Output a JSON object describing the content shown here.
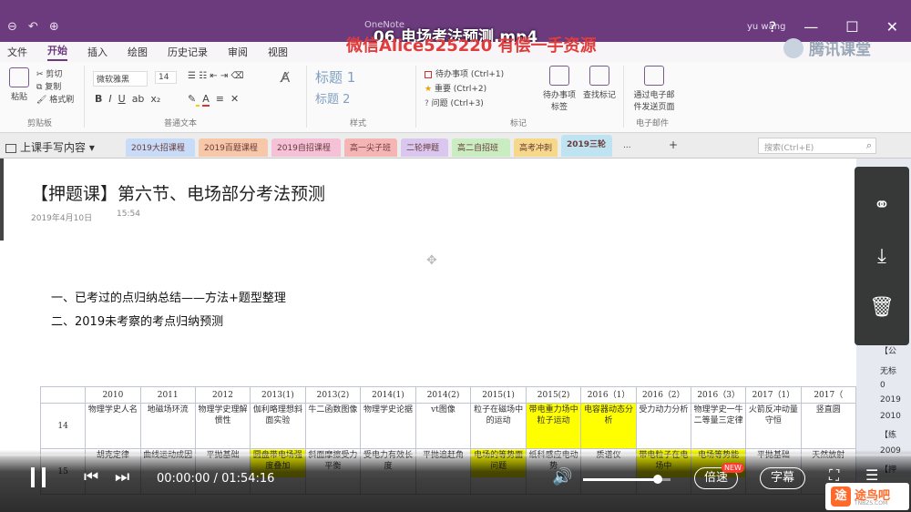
{
  "video": {
    "title": "06.电场考法预测.mp4",
    "watermark": "微信Alice525220 有偿一手资源"
  },
  "window": {
    "app_title": "OneNote",
    "user": "yu wang",
    "controls": [
      "?",
      "—",
      "☐",
      "✕"
    ]
  },
  "ribbon": {
    "tabs": [
      "文件",
      "开始",
      "插入",
      "绘图",
      "历史记录",
      "审阅",
      "视图"
    ],
    "active_tab": "开始",
    "clipboard": {
      "paste": "粘贴",
      "cut": "剪切",
      "copy": "复制",
      "format_painter": "格式刷",
      "group_label": "剪贴板"
    },
    "font": {
      "family": "微软雅黑",
      "size": "14",
      "group_label": "普通文本"
    },
    "styles": {
      "heading1": "标题 1",
      "heading2": "标题 2",
      "group_label": "样式"
    },
    "tags": {
      "items": [
        "待办事项 (Ctrl+1)",
        "重要 (Ctrl+2)",
        "问题 (Ctrl+3)"
      ],
      "todo_tag": "待办事项标签",
      "find_tags": "查找标记",
      "group_label": "标记"
    },
    "email": {
      "label": "通过电子邮件发送页面",
      "group_label": "电子邮件"
    }
  },
  "brand": {
    "tencent": "腾讯课堂"
  },
  "sections": {
    "notebook": "上课手写内容",
    "tabs": [
      {
        "label": "2019大招课程",
        "color": "#c9dcf7"
      },
      {
        "label": "2019百题课程",
        "color": "#f6c7a8"
      },
      {
        "label": "2019自招课程",
        "color": "#f4c1d6"
      },
      {
        "label": "高一尖子班",
        "color": "#f6b5b5"
      },
      {
        "label": "二轮押题",
        "color": "#d9c7f0"
      },
      {
        "label": "高二自招班",
        "color": "#c9ecc0"
      },
      {
        "label": "高考冲刺",
        "color": "#f5d88a"
      },
      {
        "label": "2019三轮",
        "color": "#bfe3f0"
      }
    ],
    "more": "...",
    "add": "+",
    "search_placeholder": "搜索(Ctrl+E)"
  },
  "page": {
    "title": "【押题课】第六节、电场部分考法预测",
    "date": "2019年4月10日",
    "time": "15:54",
    "outline": [
      "一、已考过的点归纳总结——方法+题型整理",
      "二、2019未考察的考点归纳预测"
    ]
  },
  "exam_table": {
    "headers": [
      "",
      "2010",
      "2011",
      "2012",
      "2013(1)",
      "2013(2)",
      "2014(1)",
      "2014(2)",
      "2015(1)",
      "2015(2)",
      "2016（1）",
      "2016（2）",
      "2016（3）",
      "2017（1）",
      "2017（"
    ],
    "rows": [
      {
        "no": "14",
        "cells": [
          "物理学史人名",
          "地磁场环流",
          "物理学史理解惯性",
          "伽利略理想斜面实验",
          "牛二函数图像",
          "物理学史论据",
          "vt图像",
          "粒子在磁场中的运动",
          "带电重力场中粒子运动",
          "电容器动态分析",
          "受力动力分析",
          "物理学史一牛二等量三定律",
          "火箭反冲动量守恒",
          "竖直圆"
        ],
        "highlight": [
          false,
          false,
          false,
          false,
          false,
          false,
          false,
          false,
          true,
          true,
          false,
          false,
          false,
          false
        ]
      },
      {
        "no": "15",
        "cells": [
          "胡克定律",
          "曲线运动成因",
          "平抛基础",
          "圆盘带电场强度叠加",
          "斜面摩擦受力平衡",
          "受电力有效长度",
          "平抛追赶角",
          "电场的等势面问题",
          "纸科感应电动势",
          "质谱仪",
          "带电粒子在电场中",
          "电场等势能",
          "平抛基础",
          "天然放射"
        ],
        "highlight": [
          false,
          false,
          false,
          true,
          false,
          false,
          false,
          true,
          false,
          false,
          true,
          true,
          false,
          false
        ]
      }
    ]
  },
  "side_fragments": [
    "【公",
    "无标",
    "0",
    "2019",
    "2010",
    "【练",
    "2009",
    "【押"
  ],
  "share_panel": {
    "buttons": [
      "share-icon",
      "download-icon",
      "trash-icon"
    ]
  },
  "player": {
    "current_time": "00:00:00",
    "separator": "/",
    "total_time": "01:54:16",
    "progress_fraction": 0.0,
    "volume_fraction": 0.85,
    "speed_label": "倍速",
    "new_badge": "NEW",
    "subtitle_label": "字幕"
  },
  "site_logo": {
    "name": "途鸟吧",
    "sub": "TNBZS.COM"
  }
}
